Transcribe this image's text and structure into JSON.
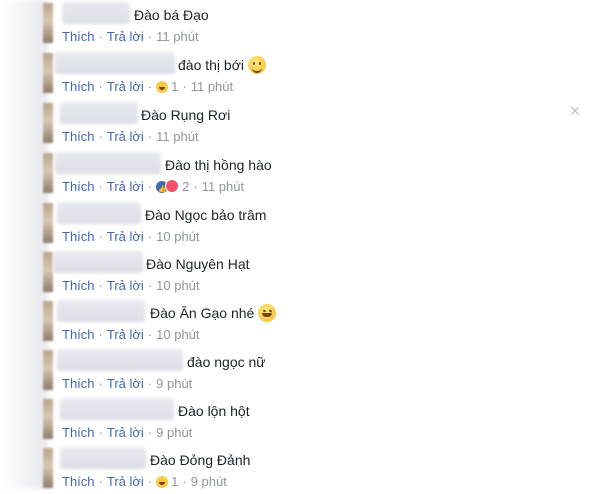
{
  "close_label": "×",
  "comments": [
    {
      "text": "Đào bá Đạo",
      "like": "Thích",
      "reply": "Trả lời",
      "time": "11 phút",
      "emoji": "",
      "reaction_count": ""
    },
    {
      "text": "đào thị bới",
      "like": "Thích",
      "reply": "Trả lời",
      "time": "11 phút",
      "emoji": "smile",
      "reaction_count": "1"
    },
    {
      "text": "Đào Rụng Rơi",
      "like": "Thích",
      "reply": "Trả lời",
      "time": "11 phút",
      "emoji": "",
      "reaction_count": ""
    },
    {
      "text": "Đào thị hồng hào",
      "like": "Thích",
      "reply": "Trả lời",
      "time": "11 phút",
      "emoji": "",
      "reaction_count": "2"
    },
    {
      "text": "Đào Ngọc bảo trâm",
      "like": "Thích",
      "reply": "Trả lời",
      "time": "10 phút",
      "emoji": "",
      "reaction_count": ""
    },
    {
      "text": "Đào Nguyên Hạt",
      "like": "Thích",
      "reply": "Trả lời",
      "time": "10 phút",
      "emoji": "",
      "reaction_count": ""
    },
    {
      "text": "Đào Ăn Gạo nhé",
      "like": "Thích",
      "reply": "Trả lời",
      "time": "10 phút",
      "emoji": "grin",
      "reaction_count": ""
    },
    {
      "text": "đào ngọc nữ",
      "like": "Thích",
      "reply": "Trả lời",
      "time": "9 phút",
      "emoji": "",
      "reaction_count": ""
    },
    {
      "text": "Đào lộn hột",
      "like": "Thích",
      "reply": "Trả lời",
      "time": "9 phút",
      "emoji": "",
      "reaction_count": ""
    },
    {
      "text": "Đào Đỏng Đảnh",
      "like": "Thích",
      "reply": "Trả lời",
      "time": "9 phút",
      "emoji": "",
      "reaction_count": "1"
    }
  ]
}
